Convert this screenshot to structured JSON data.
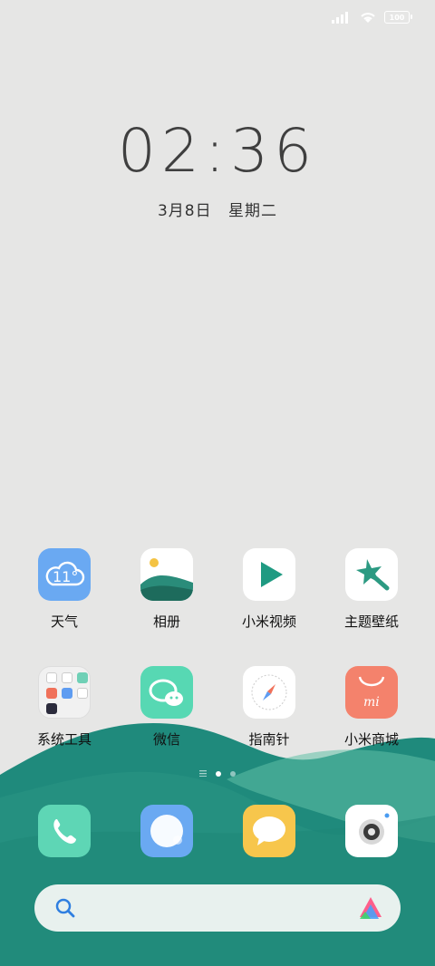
{
  "status_bar": {
    "battery": "100"
  },
  "lockclock": {
    "time": "02:36",
    "date": "3月8日",
    "weekday": "星期二"
  },
  "apps": [
    {
      "label": "天气",
      "temp": "11°"
    },
    {
      "label": "相册"
    },
    {
      "label": "小米视频"
    },
    {
      "label": "主题壁纸"
    },
    {
      "label": "系统工具"
    },
    {
      "label": "微信"
    },
    {
      "label": "指南针"
    },
    {
      "label": "小米商城"
    }
  ],
  "dock": [
    {
      "name": "phone-icon"
    },
    {
      "name": "browser-icon"
    },
    {
      "name": "messages-icon"
    },
    {
      "name": "camera-icon"
    }
  ],
  "colors": {
    "wave_dark": "#1f8a7c",
    "wave_light": "#4fb29e"
  }
}
